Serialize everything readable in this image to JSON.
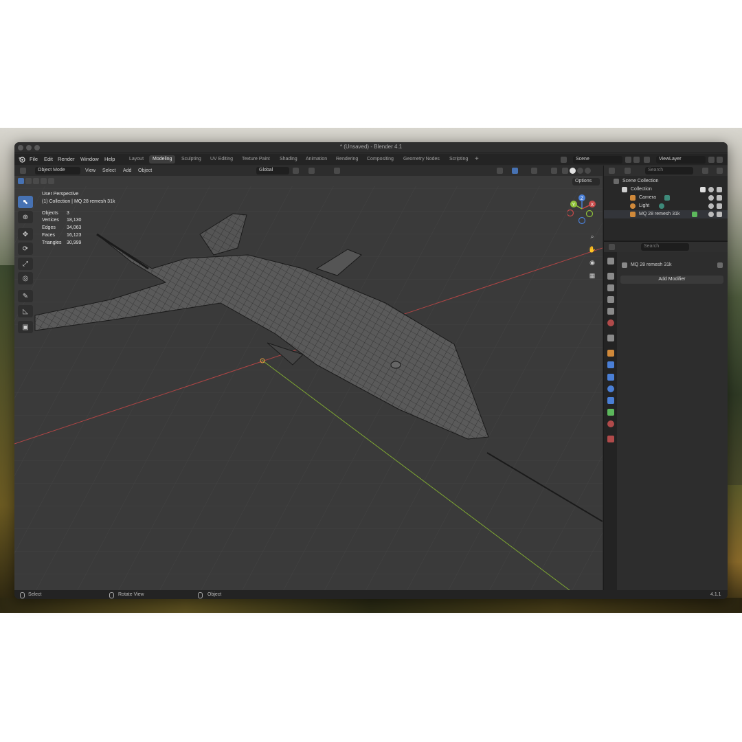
{
  "window": {
    "title": "* (Unsaved) - Blender 4.1"
  },
  "menu": [
    "File",
    "Edit",
    "Render",
    "Window",
    "Help"
  ],
  "workspaces": [
    "Layout",
    "Modeling",
    "Sculpting",
    "UV Editing",
    "Texture Paint",
    "Shading",
    "Animation",
    "Rendering",
    "Compositing",
    "Geometry Nodes",
    "Scripting"
  ],
  "active_workspace": "Modeling",
  "scene": {
    "scene_name": "Scene",
    "view_layer": "ViewLayer"
  },
  "viewport": {
    "mode": "Object Mode",
    "header_menu": [
      "View",
      "Select",
      "Add",
      "Object"
    ],
    "transform_orientation": "Global",
    "options_label": "Options",
    "perspective": "User Perspective",
    "collection_info": "(1) Collection | MQ 28 remesh 31k",
    "stats": [
      {
        "label": "Objects",
        "value": "3"
      },
      {
        "label": "Vertices",
        "value": "18,130"
      },
      {
        "label": "Edges",
        "value": "34,063"
      },
      {
        "label": "Faces",
        "value": "16,123"
      },
      {
        "label": "Triangles",
        "value": "30,999"
      }
    ],
    "gizmo_axes": {
      "x": "X",
      "y": "Y",
      "z": "Z"
    }
  },
  "outliner": {
    "search_placeholder": "Search",
    "scene_collection": "Scene Collection",
    "collection": "Collection",
    "items": [
      "Camera",
      "Light",
      "MQ 28 remesh 31k"
    ]
  },
  "properties": {
    "search_placeholder": "Search",
    "object_name": "MQ 28 remesh 31k",
    "add_modifier": "Add Modifier"
  },
  "statusbar": {
    "select": "Select",
    "rotate": "Rotate View",
    "object": "Object",
    "version": "4.1.1"
  },
  "colors": {
    "accent": "#4772b3",
    "x_axis": "#c84a4a",
    "y_axis": "#8fc23a",
    "z_axis": "#4a7fd6"
  }
}
